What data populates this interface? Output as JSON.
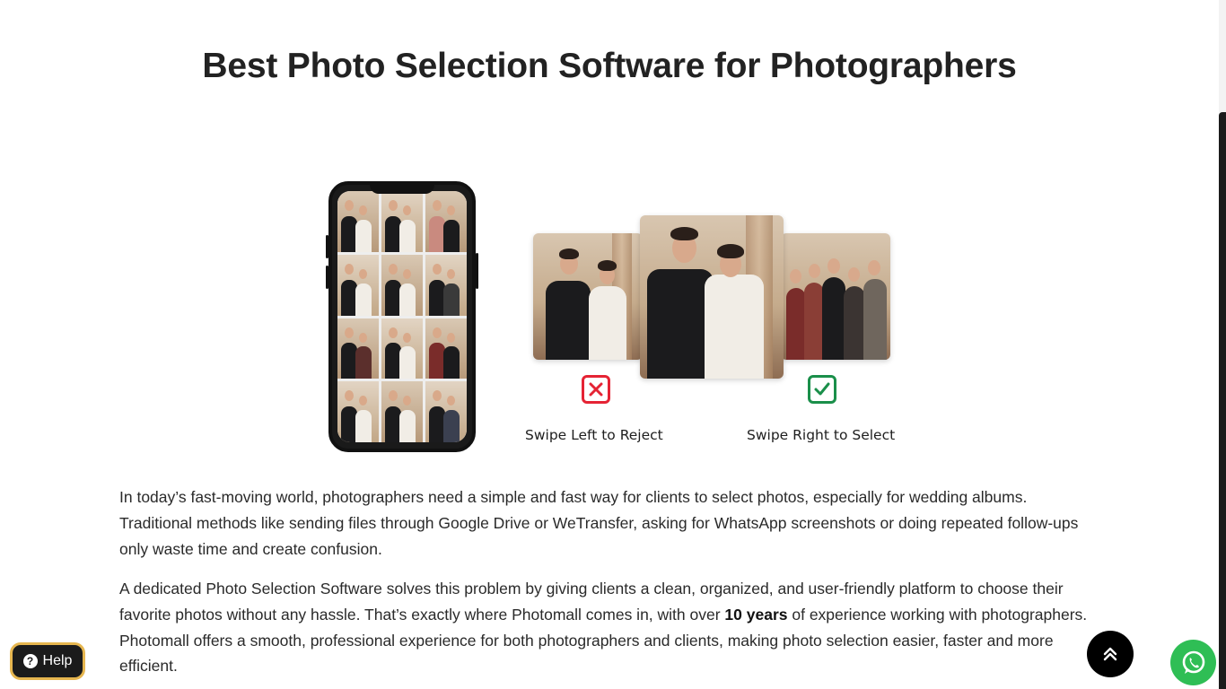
{
  "page": {
    "title": "Best Photo Selection Software for Photographers"
  },
  "illustration": {
    "swipe_left_label": "Swipe Left to Reject",
    "swipe_right_label": "Swipe Right to Select",
    "reject_color": "#e52334",
    "select_color": "#1a8f4a"
  },
  "content": {
    "paragraph1": "In today’s fast-moving world, photographers need a simple and fast way for clients to select photos, especially for wedding albums. Traditional methods like sending files through Google Drive or WeTransfer, asking for WhatsApp screenshots or doing repeated follow-ups only waste time and create confusion.",
    "paragraph2_before": "A dedicated Photo Selection Software solves this problem by giving clients a clean, organized, and user-friendly platform to choose their favorite photos without any hassle. That’s exactly where Photomall comes in, with over ",
    "paragraph2_bold": "10 years",
    "paragraph2_after": " of experience working with photographers. Photomall offers a smooth, professional experience for both photographers and clients, making photo selection easier, faster and more efficient."
  },
  "floating": {
    "help_label": "Help",
    "help_icon_glyph": "?",
    "help_border_color": "#e6b64f",
    "whatsapp_color": "#2fbe55"
  }
}
